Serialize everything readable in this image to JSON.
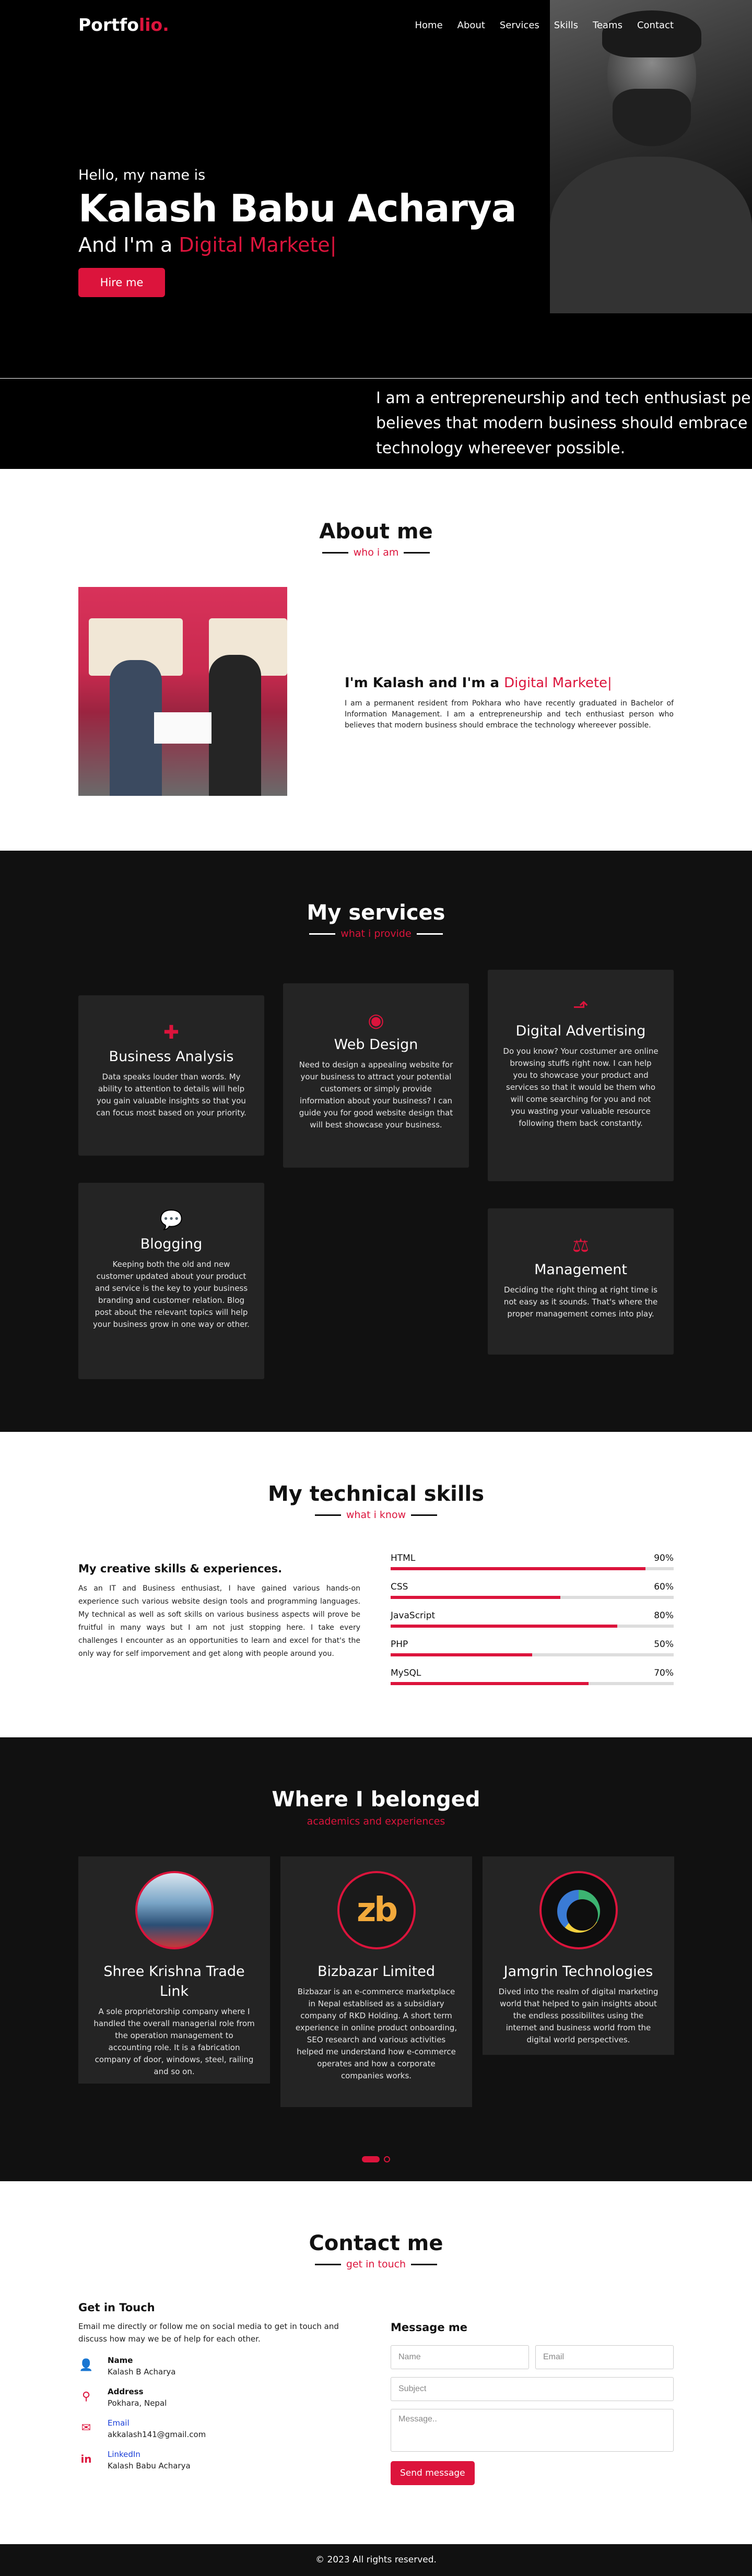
{
  "nav": {
    "logo_main": "Portfo",
    "logo_accent": "lio.",
    "items": [
      "Home",
      "About",
      "Services",
      "Skills",
      "Teams",
      "Contact"
    ]
  },
  "hero": {
    "hello": "Hello, my name is",
    "name": "Kalash Babu Acharya",
    "role_prefix": "And I'm a",
    "role_typed": "Digital Markete",
    "caret": "|",
    "hire_label": "Hire me"
  },
  "strip": {
    "lines": [
      "I am a entrepreneurship and  tech enthusiast person",
      "believes that modern business should embrace the",
      "technology whereever possible."
    ]
  },
  "about": {
    "title": "About me",
    "subtitle": "who i am",
    "heading_prefix": "I'm Kalash and I'm a",
    "heading_typed": "Digital Markete",
    "caret": "|",
    "paragraph": "I am a permanent resident from Pokhara who have recently graduated in Bachelor of Information Management. I am a entrepreneurship and tech enthusiast person who believes that modern business should embrace the technology whereever possible."
  },
  "services": {
    "title": "My services",
    "subtitle": "what i provide",
    "items": [
      {
        "icon": "puzzle-icon",
        "title": "Business Analysis",
        "text": "Data speaks louder than words. My ability to attention to details will help you gain valuable insights so that you can focus most based on your priority."
      },
      {
        "icon": "globe-icon",
        "title": "Web Design",
        "text": "Need to design a appealing website for your business to attract your potential customers or simply provide information about your business? I can guide you for good website design that will best showcase your business."
      },
      {
        "icon": "chart-line-icon",
        "title": "Digital Advertising",
        "text": "Do you know? Your costumer are online browsing stuffs right now. I can help you to showcase your product and services so that it would be them who will come searching for you and not you wasting your valuable resource following them back constantly."
      },
      {
        "icon": "comments-icon",
        "title": "Blogging",
        "text": "Keeping both the old and new customer updated about your product and service is the key to your business branding and customer relation. Blog post about the relevant topics will help your business grow in one way or other."
      },
      {
        "icon": "scale-icon",
        "title": "Management",
        "text": "Deciding the right thing at right time is not easy as it sounds. That's where the proper management comes into play."
      }
    ]
  },
  "skills": {
    "title": "My technical skills",
    "subtitle": "what i know",
    "left_title": "My creative skills & experiences.",
    "left_text": "As an IT and Business enthusiast, I have gained various hands-on experience such various website design tools and programming languages. My technical as well as soft skills on various business aspects will prove be fruitful in many ways but I am not just stopping here. I take every challenges I encounter as an opportunities to learn and excel for that's the only way for self imporvement and get along with people around you.",
    "bars": [
      {
        "name": "HTML",
        "percent": "90%",
        "level": 90
      },
      {
        "name": "CSS",
        "percent": "60%",
        "level": 60
      },
      {
        "name": "JavaScript",
        "percent": "80%",
        "level": 80
      },
      {
        "name": "PHP",
        "percent": "50%",
        "level": 50
      },
      {
        "name": "MySQL",
        "percent": "70%",
        "level": 70
      }
    ]
  },
  "experience": {
    "title": "Where I belonged",
    "subtitle": "academics and experiences",
    "items": [
      {
        "title": "Shree Krishna Trade Link",
        "text": "A sole proprietorship company where I handled the overall managerial role from the operation management to accounting role. It is a fabrication company of door, windows, steel, railing and so on."
      },
      {
        "title": "Bizbazar Limited",
        "logo": "zb",
        "text": "Bizbazar is an e-commerce marketplace in Nepal establised as a subsidiary company of RKD Holding. A short term experience in online product onboarding, SEO research and various activities helped me understand how e-commerce operates and how a corporate companies works."
      },
      {
        "title": "Jamgrin Technologies",
        "text": "Dived into the realm of digital marketing world that helped to gain insights about the endless possibilites using the internet and business world from the digital world perspectives."
      }
    ]
  },
  "contact": {
    "title": "Contact me",
    "subtitle": "get in touch",
    "left_title": "Get in Touch",
    "intro": "Email me directly or follow me on social media to get in touch and discuss how may we be of help for each other.",
    "items": [
      {
        "icon": "user-icon",
        "label": "Name",
        "value": "Kalash B Acharya"
      },
      {
        "icon": "map-pin-icon",
        "label": "Address",
        "value": "Pokhara, Nepal"
      },
      {
        "icon": "envelope-icon",
        "label": "Email",
        "value": "akkalash141@gmail.com"
      },
      {
        "icon": "linkedin-icon",
        "label": "LinkedIn",
        "value": "Kalash Babu Acharya"
      }
    ],
    "form_title": "Message me",
    "name_placeholder": "Name",
    "email_placeholder": "Email",
    "subject_placeholder": "Subject",
    "message_placeholder": "Message..",
    "send_label": "Send message"
  },
  "footer": {
    "text": "© 2023 All rights reserved."
  },
  "colors": {
    "accent": "#dc143c",
    "dark": "#111111",
    "card": "#242424"
  }
}
